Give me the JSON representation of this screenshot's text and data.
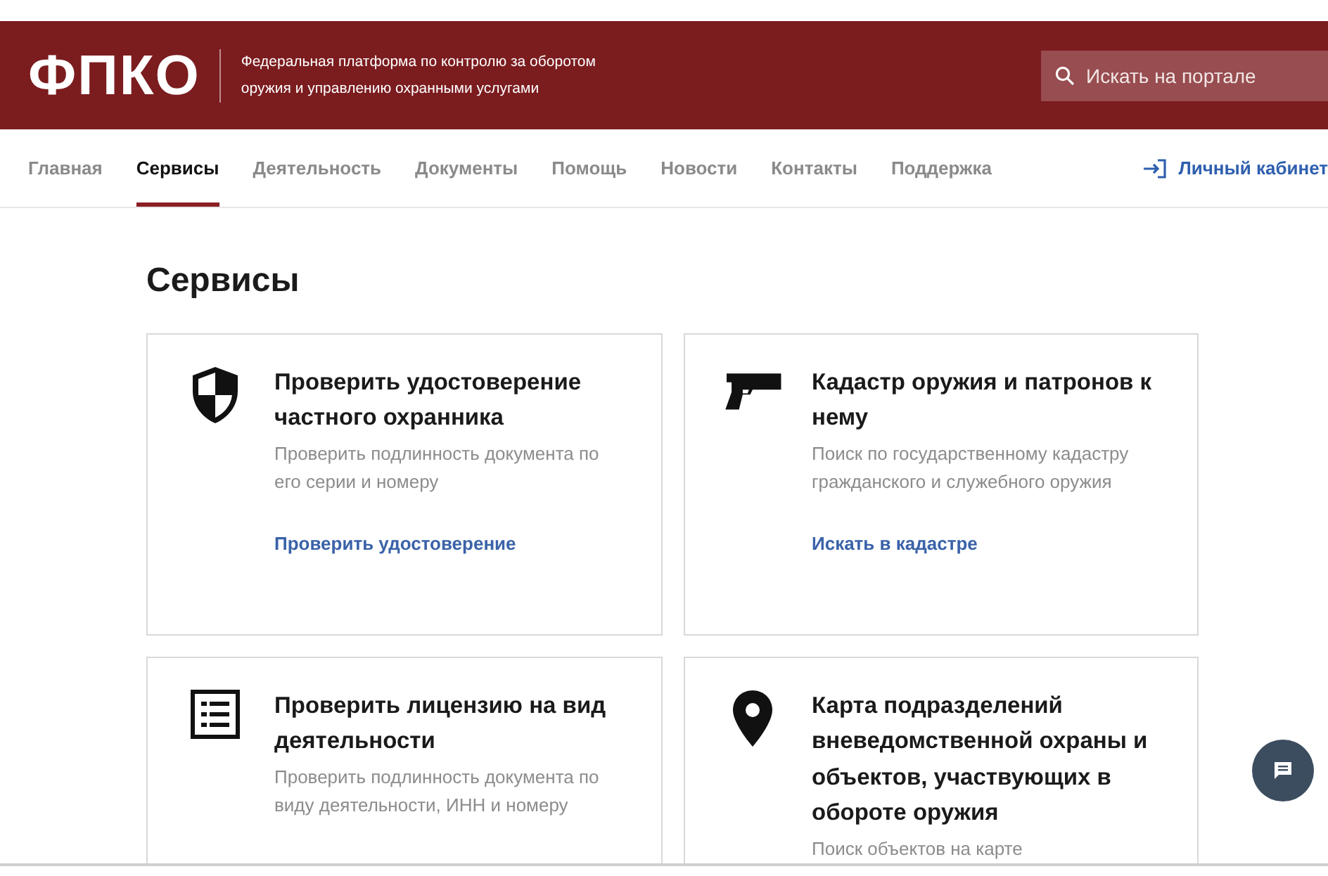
{
  "header": {
    "logo": "ФПКО",
    "tagline_lines": [
      "Федеральная платформа по контролю за оборотом",
      "оружия и управлению охранными услугами"
    ],
    "search": {
      "placeholder": "Искать на портале"
    }
  },
  "nav": {
    "items": [
      {
        "label": "Главная",
        "selected": false
      },
      {
        "label": "Сервисы",
        "selected": true
      },
      {
        "label": "Деятельность",
        "selected": false
      },
      {
        "label": "Документы",
        "selected": false
      },
      {
        "label": "Помощь",
        "selected": false
      },
      {
        "label": "Новости",
        "selected": false
      },
      {
        "label": "Контакты",
        "selected": false
      },
      {
        "label": "Поддержка",
        "selected": false
      }
    ],
    "login": "Личный кабинет"
  },
  "page_title": "Сервисы",
  "cards": [
    {
      "kind": "shield",
      "title": "Проверить удостоверение частного охранника",
      "description": "Проверить подлинность документа по его серии и номеру",
      "link": "Проверить удостоверение"
    },
    {
      "kind": "pistol",
      "title": "Кадастр оружия и патронов к нему",
      "description": "Поиск по государственному кадастру гражданского и служебного оружия",
      "link": "Искать в кадастре"
    },
    {
      "kind": "list",
      "title": "Проверить лицензию на вид деятельности",
      "description": "Проверить подлинность документа по виду деятельности, ИНН и номеру"
    },
    {
      "kind": "pin",
      "title": "Карта подразделений вневедомственной охраны и объектов, участвующих в обороте оружия",
      "description": "Поиск объектов на карте"
    }
  ]
}
